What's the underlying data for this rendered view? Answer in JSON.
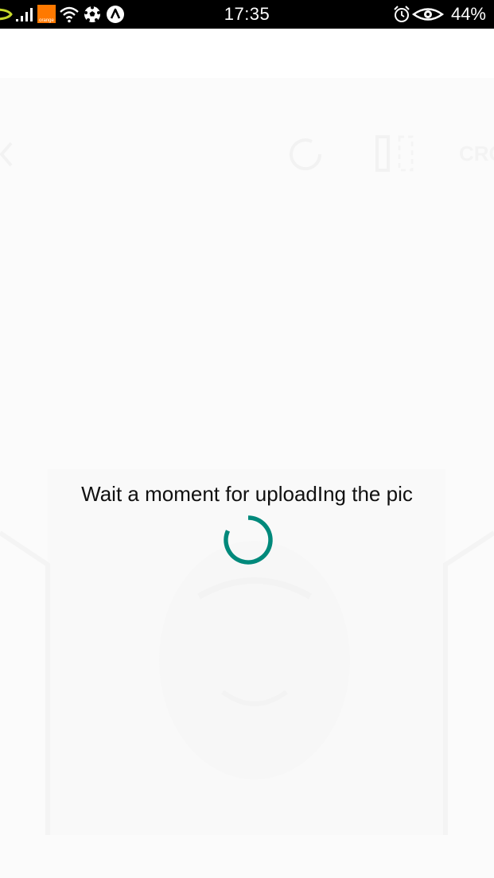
{
  "status_bar": {
    "time": "17:35",
    "battery": "44%",
    "carrier_badge": "orange",
    "icons": [
      "signal-icon",
      "orange-carrier-icon",
      "wifi-icon",
      "soccer-ball-icon",
      "nav-a-icon",
      "alarm-icon",
      "eye-icon"
    ]
  },
  "background_app": {
    "crop_label": "CRO"
  },
  "loading": {
    "message": "Wait a moment for uploadIng the pic"
  },
  "colors": {
    "accent": "#00897b",
    "status_bar": "#000000",
    "overlay": "#fbfbfb"
  }
}
